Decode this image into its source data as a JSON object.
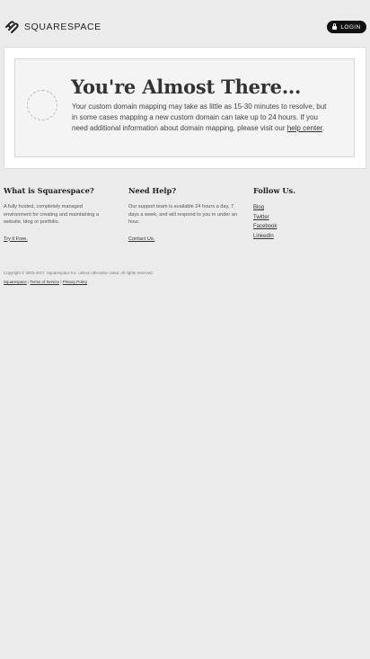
{
  "header": {
    "logo_text": "SQUARESPACE",
    "login_label": "LOGIN"
  },
  "main": {
    "headline": "You're Almost There...",
    "message": "Your custom domain mapping may take as little as 15-30 minutes to resolve, but in some cases mapping a new custom domain can take up to 24 hours. If you need additional information about domain mapping, please visit our ",
    "help_link": "help center",
    "message_end": "."
  },
  "footer": {
    "what": {
      "title": "What is Squarespace?",
      "text": "A fully hosted, completely managed environment for creating and maintaining a website, blog or portfolio.",
      "link": "Try it Free."
    },
    "help": {
      "title": "Need Help?",
      "text": "Our support team is available 24 hours a day, 7 days a week, and will respond to you in under an hour.",
      "link": "Contact Us."
    },
    "follow": {
      "title": "Follow Us.",
      "links": [
        "Blog",
        "Twitter",
        "Facebook",
        "LinkedIn"
      ]
    },
    "copyright": "Copyright © 2003-2017, Squarespace Inc. unless otherwise noted. All rights reserved.",
    "legal": {
      "squarespace": "Squarespace",
      "sep": " | ",
      "terms": "Terms of Service",
      "privacy": "Privacy Policy"
    }
  },
  "colors": {
    "background": "#ebebeb",
    "login_bg": "#111111",
    "panel_bg": "#ffffff"
  },
  "icons": {
    "logo": "squarespace-logo-icon",
    "login": "lock-icon",
    "loading": "loading-spinner-icon"
  }
}
